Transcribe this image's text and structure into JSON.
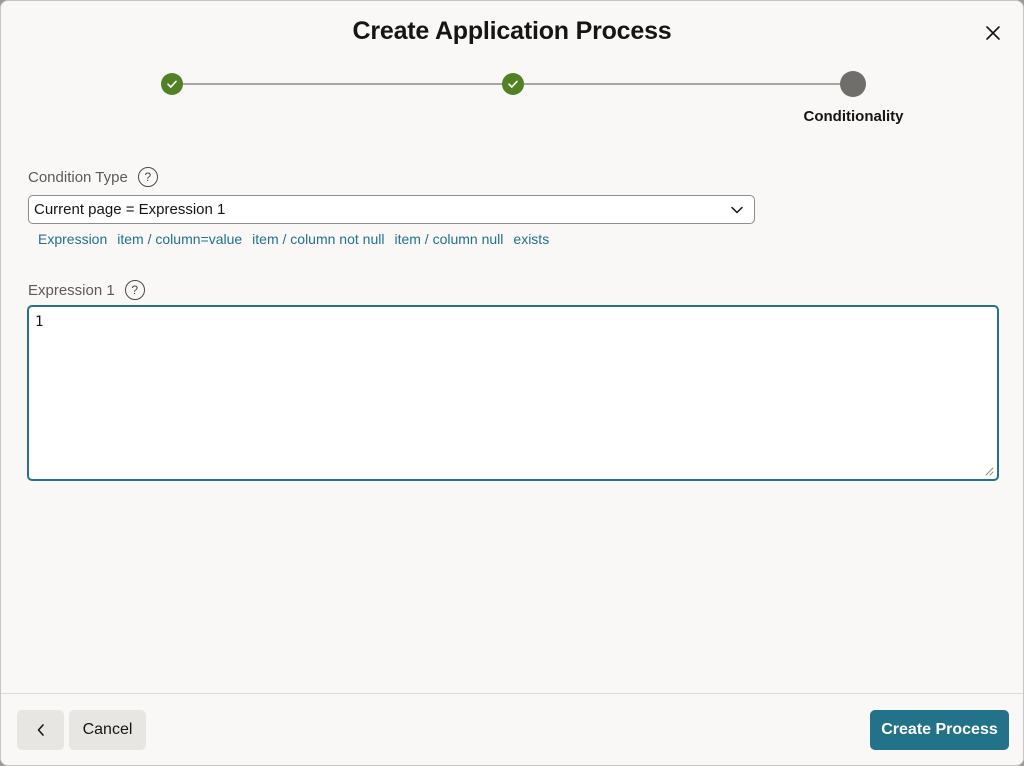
{
  "dialog": {
    "title": "Create Application Process"
  },
  "wizard": {
    "steps": [
      {
        "state": "done"
      },
      {
        "state": "done"
      },
      {
        "state": "current",
        "label": "Conditionality"
      }
    ],
    "colors": {
      "done": "#508223",
      "current": "#6f6e6b",
      "line": "#a7a5a0"
    }
  },
  "condition_type": {
    "label": "Condition Type",
    "value": "Current page = Expression 1",
    "quick_picks": [
      "Expression",
      "item / column=value",
      "item / column not null",
      "item / column null",
      "exists"
    ]
  },
  "expression1": {
    "label": "Expression 1",
    "value": "1"
  },
  "footer": {
    "back_icon": "chevron-left-icon",
    "cancel_label": "Cancel",
    "create_label": "Create Process"
  },
  "colors": {
    "accent": "#227289",
    "background": "#f9f8f6"
  }
}
